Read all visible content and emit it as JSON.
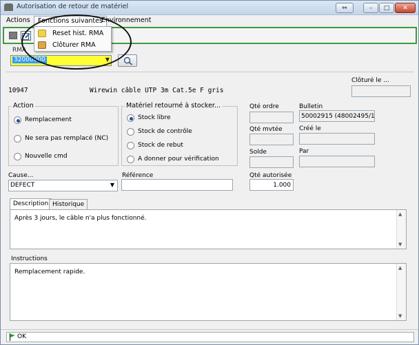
{
  "window": {
    "title": "Autorisation de retour de matériel",
    "controls": {
      "restore": "⇔",
      "minimize": "–",
      "maximize": "□",
      "close": "✕"
    }
  },
  "menu": {
    "actions": "Actions",
    "fonctions": "Fonctions suivantes",
    "environnement": "Environnement",
    "dropdown_items": [
      "Reset hist. RMA",
      "Clôturer RMA"
    ]
  },
  "rma": {
    "label": "RMA",
    "value": "32000000"
  },
  "item": {
    "code": "10947",
    "description": "Wirewin câble UTP 3m Cat.5e F gris"
  },
  "cloture": {
    "label": "Clôturé le ...",
    "value": ""
  },
  "action_group": {
    "title": "Action",
    "options": [
      "Remplacement",
      "Ne sera pas remplacé (NC)",
      "Nouvelle cmd"
    ],
    "selected": "Remplacement"
  },
  "materiel_group": {
    "title": "Matériel retourné à stocker...",
    "options": [
      "Stock libre",
      "Stock de contrôle",
      "Stock de rebut",
      "A donner pour vérification"
    ],
    "selected": "Stock libre"
  },
  "fields": {
    "qte_ordre": "Qté ordre",
    "qte_mvtee": "Qté mvtée",
    "solde": "Solde",
    "qte_autorisee": "Qté autorisée",
    "qte_autorisee_value": "1.000",
    "bulletin": "Bulletin",
    "bulletin_value": "50002915 (48002495/10)",
    "cree_le": "Créé le",
    "par": "Par",
    "cause": "Cause...",
    "cause_value": "DEFECT",
    "reference": "Référence",
    "reference_value": ""
  },
  "tabs": [
    "Description",
    "Historique"
  ],
  "description_text": "Après 3 jours, le câble n'a plus fonctionné.",
  "instructions": {
    "label": "Instructions",
    "text": "Remplacement rapide."
  },
  "status": {
    "text": "OK"
  },
  "colors": {
    "rma_background": "#ffff33",
    "selection": "#3399ff",
    "toolbar_border": "#3c9b3c"
  }
}
